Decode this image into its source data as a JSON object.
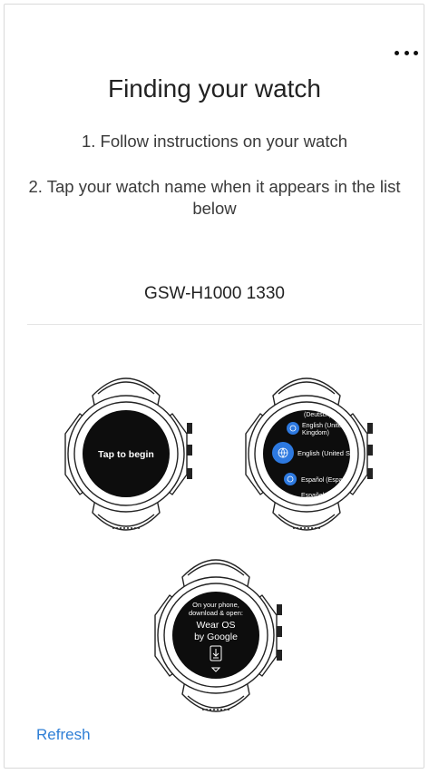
{
  "header": {
    "title": "Finding your watch",
    "more_icon": "more-horizontal-icon"
  },
  "instructions": {
    "step1": "1. Follow instructions on your watch",
    "step2": "2. Tap your watch name when it appears in the list below"
  },
  "device": {
    "name": "GSW-H1000 1330"
  },
  "watches": {
    "watch1": {
      "screen_text": "Tap to begin"
    },
    "watch2": {
      "items": [
        "(Deutsch)",
        "English (United",
        "Kingdom)",
        "English (United States)",
        "Español (España)",
        "Español"
      ],
      "icon": "globe-icon"
    },
    "watch3": {
      "line1": "On your phone,",
      "line2": "download & open:",
      "line3": "Wear OS",
      "line4": "by Google",
      "icon": "download-icon"
    }
  },
  "footer": {
    "refresh_label": "Refresh"
  },
  "colors": {
    "accent": "#2f7fd6",
    "watch_screen": "#0d0d0d",
    "globe_blue": "#2d79e0"
  }
}
